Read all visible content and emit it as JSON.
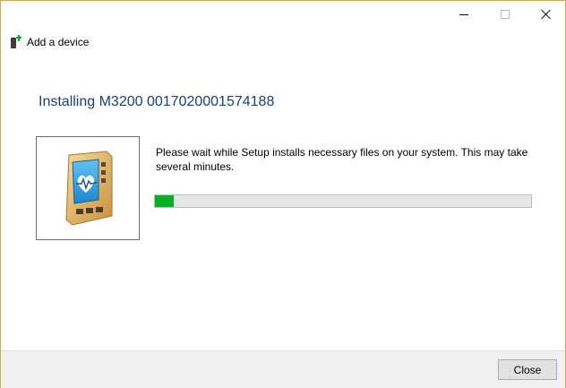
{
  "window": {
    "border_color": "#d9a54c",
    "caption_buttons": [
      "minimize-icon",
      "maximize-icon",
      "close-icon"
    ]
  },
  "header": {
    "label": "Add a device",
    "icon": "device-add-icon"
  },
  "main": {
    "title": "Installing M3200 0017020001574188",
    "title_color": "#1a3e7a",
    "device_icon": "medical-device-icon",
    "message": "Please wait while Setup installs necessary files on your system. This may take several minutes.",
    "progress": {
      "value_percent": 5,
      "fill_color": "#06b025"
    }
  },
  "footer": {
    "close_label": "Close"
  }
}
